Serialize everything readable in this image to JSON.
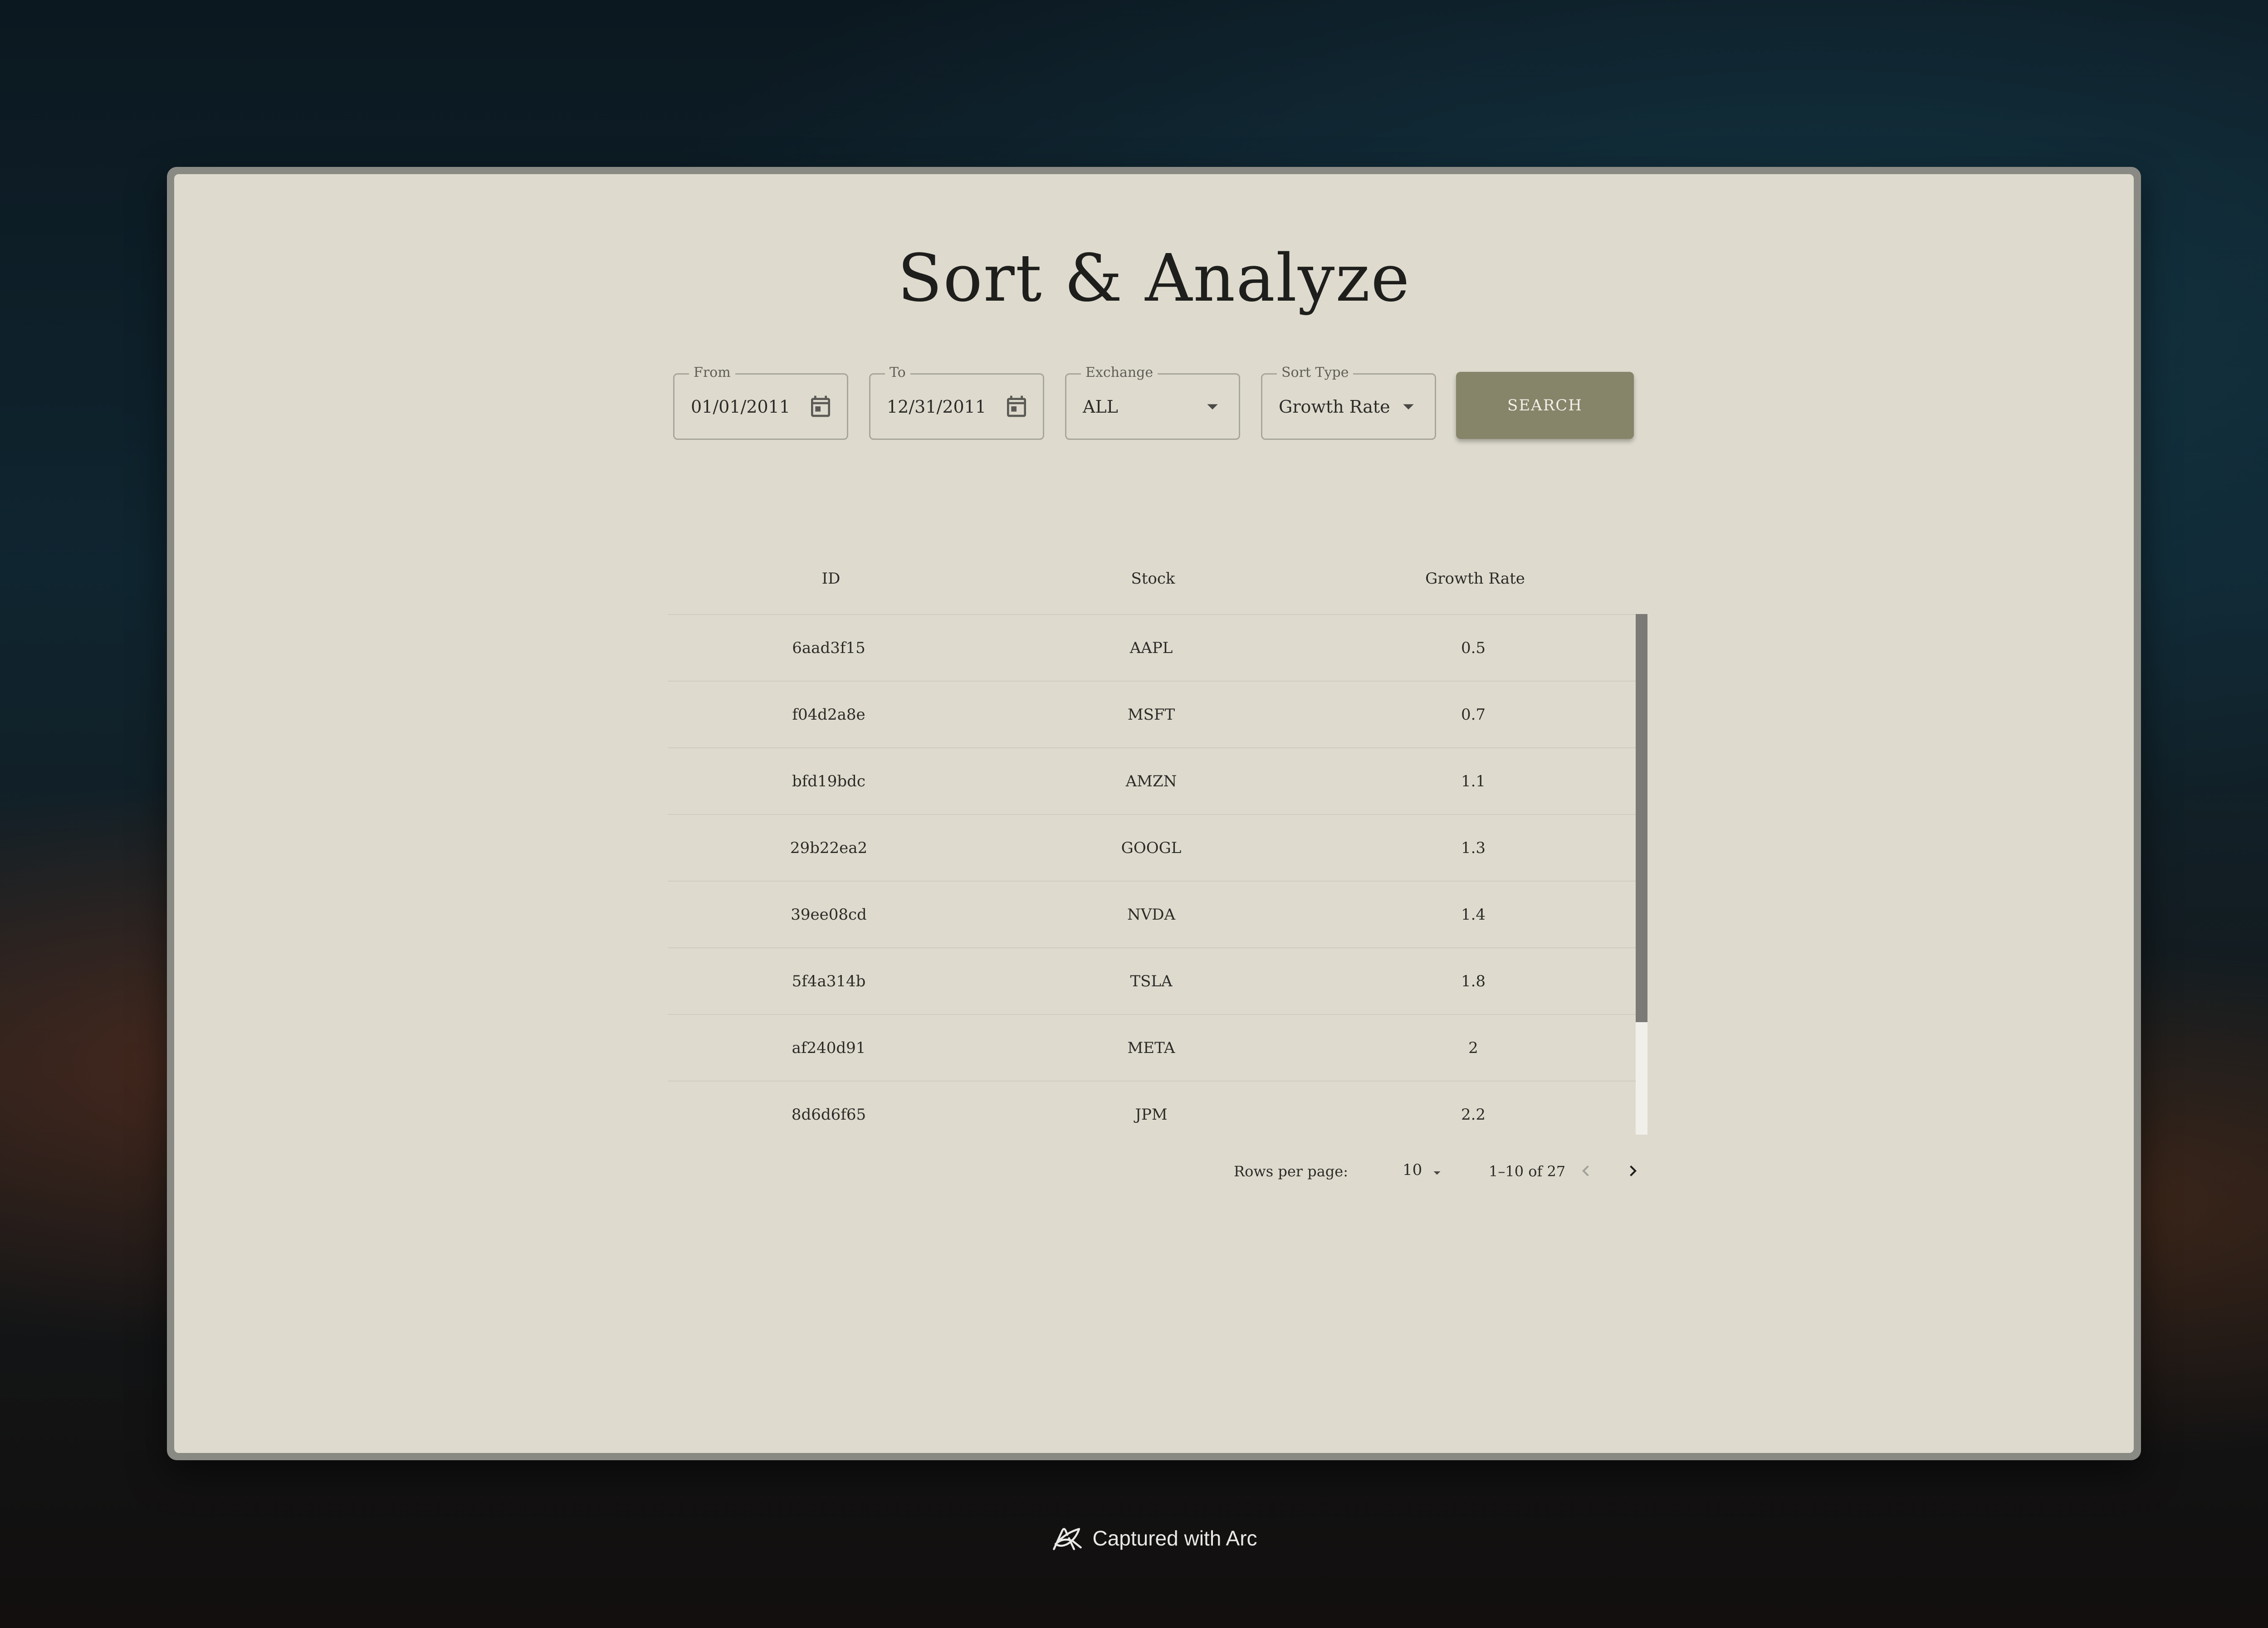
{
  "page": {
    "title": "Sort & Analyze"
  },
  "filters": {
    "from": {
      "label": "From",
      "value": "01/01/2011",
      "icon": "calendar-icon"
    },
    "to": {
      "label": "To",
      "value": "12/31/2011",
      "icon": "calendar-icon"
    },
    "exchange": {
      "label": "Exchange",
      "value": "ALL",
      "icon": "caret-down-icon"
    },
    "sort_type": {
      "label": "Sort Type",
      "value": "Growth Rate",
      "icon": "caret-down-icon"
    },
    "search_label": "SEARCH"
  },
  "table": {
    "columns": [
      "ID",
      "Stock",
      "Growth Rate"
    ],
    "rows": [
      [
        "6aad3f15",
        "AAPL",
        "0.5"
      ],
      [
        "f04d2a8e",
        "MSFT",
        "0.7"
      ],
      [
        "bfd19bdc",
        "AMZN",
        "1.1"
      ],
      [
        "29b22ea2",
        "GOOGL",
        "1.3"
      ],
      [
        "39ee08cd",
        "NVDA",
        "1.4"
      ],
      [
        "5f4a314b",
        "TSLA",
        "1.8"
      ],
      [
        "af240d91",
        "META",
        "2"
      ],
      [
        "8d6d6f65",
        "JPM",
        "2.2"
      ]
    ]
  },
  "pagination": {
    "rows_per_page_label": "Rows per page:",
    "rows_per_page_value": "10",
    "range": "1–10 of 27"
  },
  "footer": {
    "text": "Captured with Arc"
  },
  "colors": {
    "page_bg": "#dedbce",
    "button_bg": "#868469",
    "text": "#2c2b28"
  }
}
